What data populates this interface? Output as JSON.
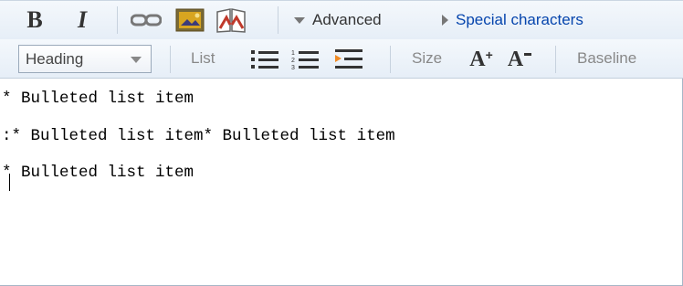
{
  "toolbar_main": {
    "bold_label": "B",
    "italic_label": "I",
    "advanced_label": "Advanced",
    "special_chars_label": "Special characters"
  },
  "toolbar_advanced": {
    "heading_select": "Heading",
    "list_label": "List",
    "size_label": "Size",
    "size_up_label": "A",
    "size_down_label": "A",
    "baseline_label": "Baseline"
  },
  "editor": {
    "lines": [
      "* Bulleted list item",
      ":* Bulleted list item* Bulleted list item",
      "* Bulleted list item"
    ]
  }
}
